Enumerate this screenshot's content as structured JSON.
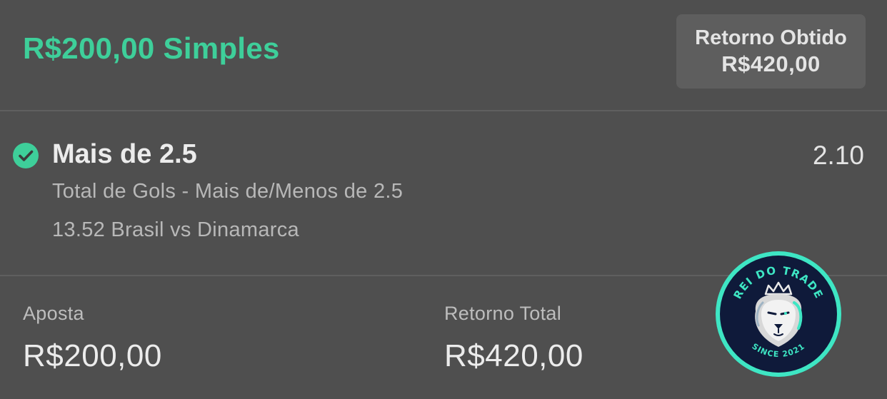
{
  "bet": {
    "stake_title": "R$200,00 Simples",
    "return_box": {
      "label": "Retorno Obtido",
      "value": "R$420,00"
    }
  },
  "selection": {
    "status_icon": "check-circle-icon",
    "name": "Mais de 2.5",
    "odds": "2.10",
    "market": "Total de Gols - Mais de/Menos de 2.5",
    "event": "13.52 Brasil vs Dinamarca"
  },
  "summary": {
    "stake_label": "Aposta",
    "stake_value": "R$200,00",
    "total_return_label": "Retorno Total",
    "total_return_value": "R$420,00"
  },
  "watermark": {
    "text_top": "REI DO TRADE",
    "text_bottom": "SINCE 2021"
  },
  "colors": {
    "background": "#4f4f4f",
    "accent": "#3ecf9a",
    "box": "#5e5e5e",
    "logo_bg": "#0f1a3a",
    "logo_ring": "#3ee6c4"
  }
}
